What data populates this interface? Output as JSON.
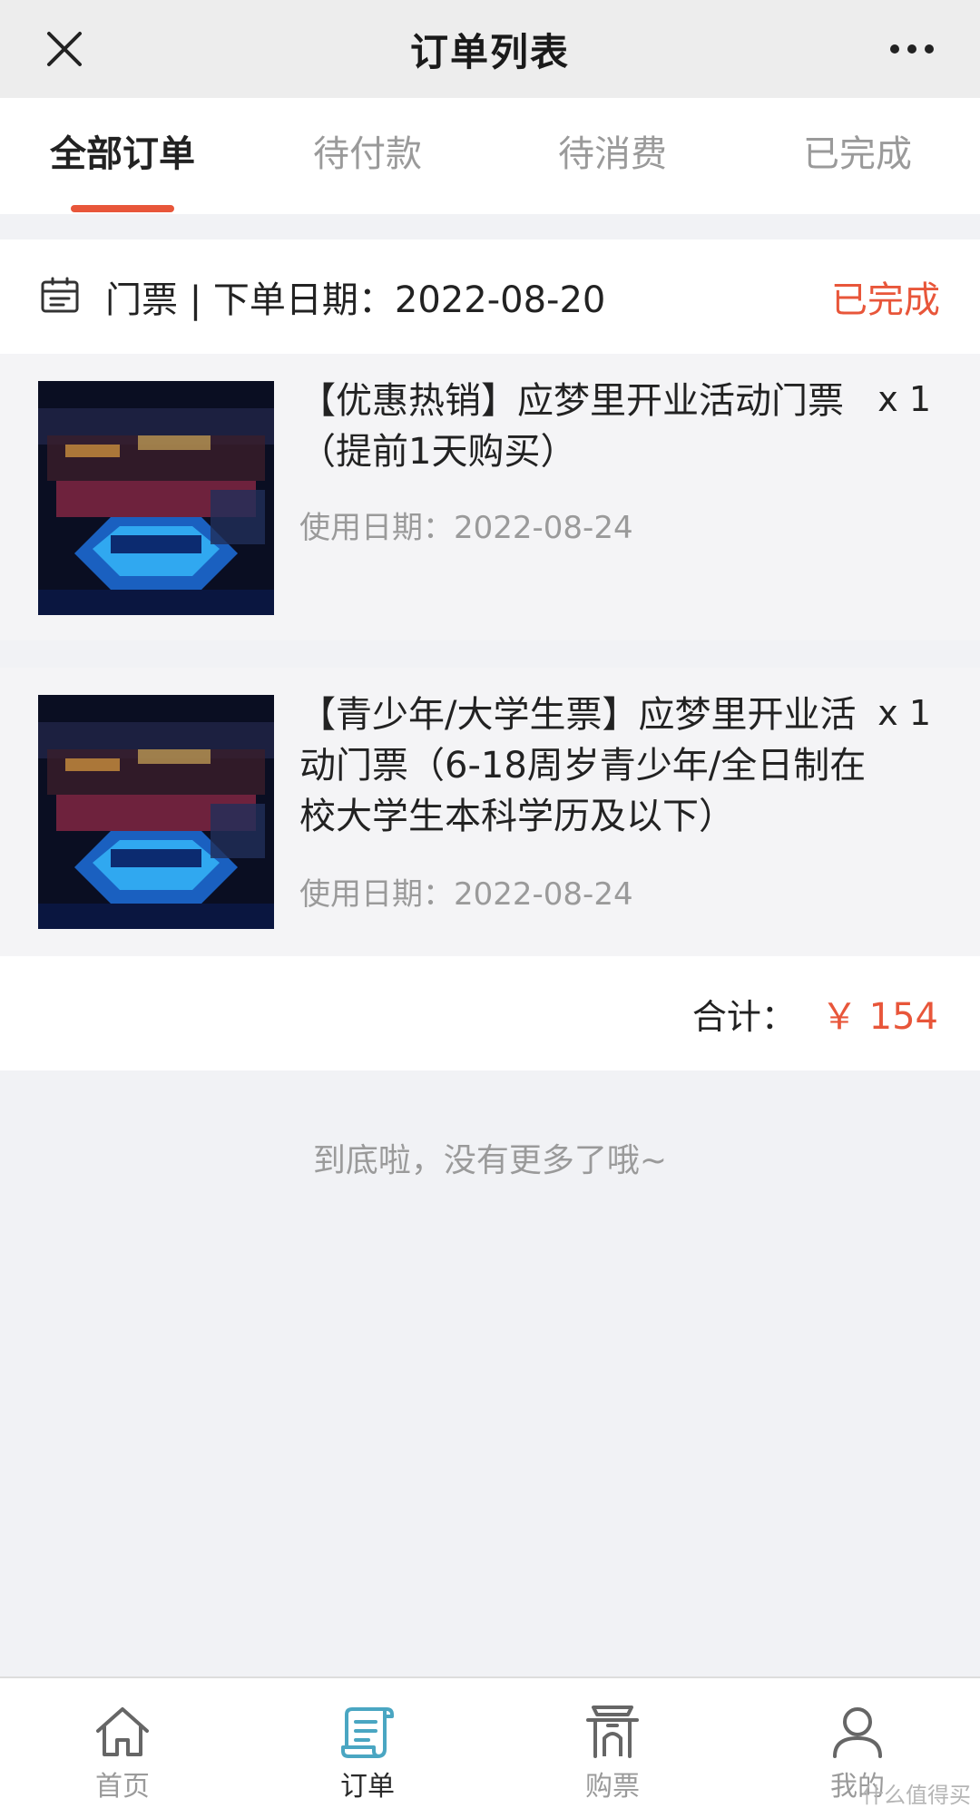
{
  "window": {
    "title": "订单列表"
  },
  "tabs": [
    {
      "label": "全部订单"
    },
    {
      "label": "待付款"
    },
    {
      "label": "待消费"
    },
    {
      "label": "已完成"
    }
  ],
  "order": {
    "meta": "门票 | 下单日期：2022-08-20",
    "status": "已完成",
    "items": [
      {
        "name": "【优惠热销】应梦里开业活动门票（提前1天购买）",
        "qty": "x 1",
        "date": "使用日期：2022-08-24"
      },
      {
        "name": "【青少年/大学生票】应梦里开业活动门票（6-18周岁青少年/全日制在校大学生本科学历及以下）",
        "qty": "x 1",
        "date": "使用日期：2022-08-24"
      }
    ],
    "total_label": "合计：",
    "total_amount": "￥ 154"
  },
  "end_hint": "到底啦，没有更多了哦~",
  "nav": [
    {
      "label": "首页",
      "icon": "home-icon"
    },
    {
      "label": "订单",
      "icon": "scroll-icon"
    },
    {
      "label": "购票",
      "icon": "gate-icon"
    },
    {
      "label": "我的",
      "icon": "user-icon"
    }
  ],
  "watermark": "什么值得买",
  "colors": {
    "accent": "#e8563a",
    "order_active": "#4aa6c2"
  }
}
